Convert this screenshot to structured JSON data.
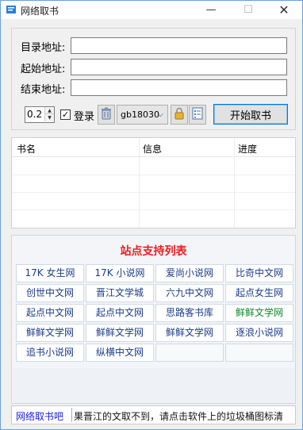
{
  "window": {
    "title": "网络取书",
    "minimize_glyph": "—",
    "maximize_glyph": "☐",
    "close_glyph": "✕"
  },
  "form": {
    "catalog_label": "目录地址:",
    "catalog_value": "",
    "start_label": "起始地址:",
    "start_value": "",
    "end_label": "结束地址:",
    "end_value": ""
  },
  "toolbar": {
    "interval_value": "0.2",
    "login_label": "登录",
    "login_checked": true,
    "encoding_selected": "gb18030",
    "start_button_label": "开始取书"
  },
  "book_list": {
    "columns": [
      "书名",
      "信息",
      "进度"
    ],
    "rows": []
  },
  "sites": {
    "title": "站点支持列表",
    "items": [
      {
        "label": "17K 女生网"
      },
      {
        "label": "17K 小说网"
      },
      {
        "label": "爱尚小说网"
      },
      {
        "label": "比奇中文网"
      },
      {
        "label": "创世中文网"
      },
      {
        "label": "晋江文学城"
      },
      {
        "label": "六九中文网"
      },
      {
        "label": "起点女生网"
      },
      {
        "label": "起点中文网"
      },
      {
        "label": "起点中文网"
      },
      {
        "label": "思路客书库"
      },
      {
        "label": "鲜鲜文学网",
        "color": "#0a8a2a"
      },
      {
        "label": "鲜鲜文学网"
      },
      {
        "label": "鲜鲜文学网"
      },
      {
        "label": "鲜鲜文学网"
      },
      {
        "label": "逐浪小说网"
      },
      {
        "label": "追书小说网"
      },
      {
        "label": "纵横中文网"
      },
      {
        "label": ""
      },
      {
        "label": ""
      }
    ]
  },
  "status": {
    "link": "网络取书吧",
    "message": "果晋江的文取不到，请点击软件上的垃圾桶图标清"
  },
  "colors": {
    "accent": "#0078d7",
    "sites_title": "#ee1c1c",
    "site_text": "#1a3a8a",
    "status_link": "#1a1ae6"
  }
}
